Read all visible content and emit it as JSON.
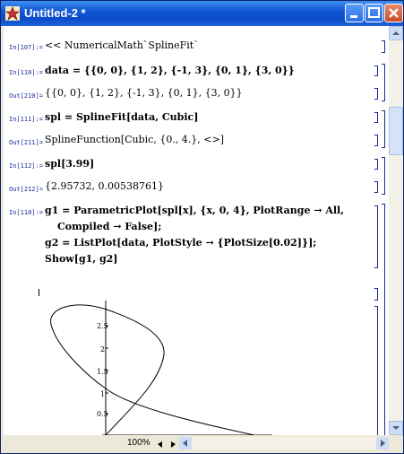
{
  "window": {
    "title": "Untitled-2 *"
  },
  "cells": [
    {
      "in_label": "In[107]:=",
      "code": "<< NumericalMath`SplineFit`"
    },
    {
      "in_label": "In[110]:=",
      "code": "data = {{0, 0}, {1, 2}, {-1, 3}, {0, 1}, {3, 0}}",
      "out_label": "Out[210]=",
      "output": "{{0, 0}, {1, 2}, {-1, 3}, {0, 1}, {3, 0}}"
    },
    {
      "in_label": "In[111]:=",
      "code": "spl = SplineFit[data, Cubic]",
      "out_label": "Out[211]=",
      "output": "SplineFunction[Cubic, {0., 4.}, <>]"
    },
    {
      "in_label": "In[112]:=",
      "code": "spl[3.99]",
      "out_label": "Out[212]=",
      "output": "{2.95732, 0.00538761}"
    },
    {
      "in_label": "In[110]:=",
      "code_lines": [
        "g1 = ParametricPlot[spl[x], {x, 0, 4}, PlotRange → All,",
        "Compiled → False];",
        "g2 = ListPlot[data, PlotStyle → {PlotSize[0.02]}];",
        "Show[g1, g2]"
      ]
    }
  ],
  "plot": {
    "y_ticks": [
      "0.5",
      "1",
      "1.5",
      "2",
      "2.5"
    ]
  },
  "status": {
    "zoom": "100%"
  }
}
